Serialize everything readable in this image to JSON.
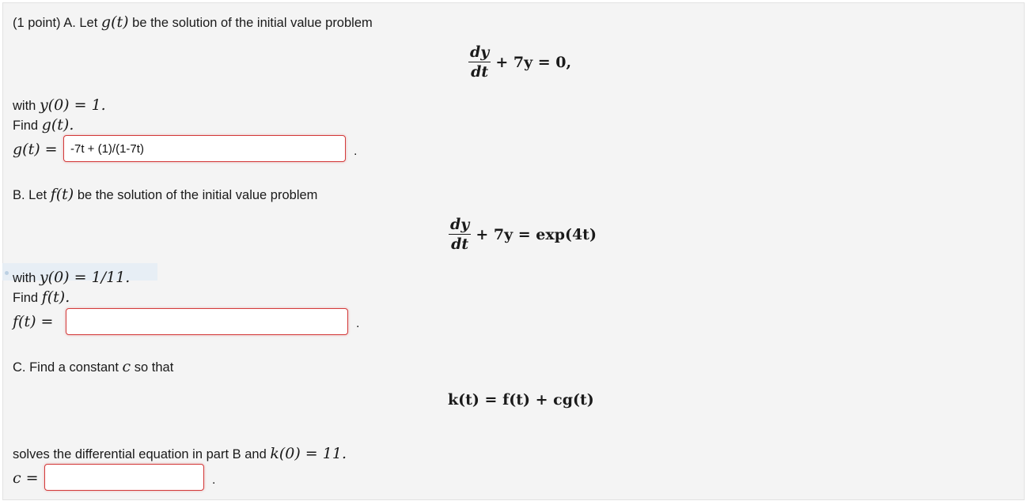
{
  "part_a": {
    "intro": "(1 point) A. Let",
    "func": "g(t)",
    "intro_tail": "be the solution of the initial value problem",
    "eq_num": "dy",
    "eq_den": "dt",
    "eq_rest": "+ 7y = 0,",
    "with_text": "with",
    "condition": "y(0) = 1.",
    "find_text": "Find",
    "find_func": "g(t).",
    "answer_label": "g(t) =",
    "answer_value": "-7t + (1)/(1-7t)",
    "period": "."
  },
  "part_b": {
    "intro": "B. Let",
    "func": "f(t)",
    "intro_tail": "be the solution of the initial value problem",
    "eq_num": "dy",
    "eq_den": "dt",
    "eq_rest": "+ 7y = exp(4t)",
    "with_text": "with",
    "condition": "y(0) = 1/11.",
    "find_text": "Find",
    "find_func": "f(t).",
    "answer_label": "f(t) =",
    "answer_value": "",
    "period": "."
  },
  "part_c": {
    "intro": "C. Find a constant",
    "var": "c",
    "intro_tail": "so that",
    "equation": "k(t) = f(t) + cg(t)",
    "solves_text": "solves the differential equation in part B and",
    "condition": "k(0) = 11.",
    "answer_label": "c =",
    "answer_value": "",
    "period": "."
  }
}
